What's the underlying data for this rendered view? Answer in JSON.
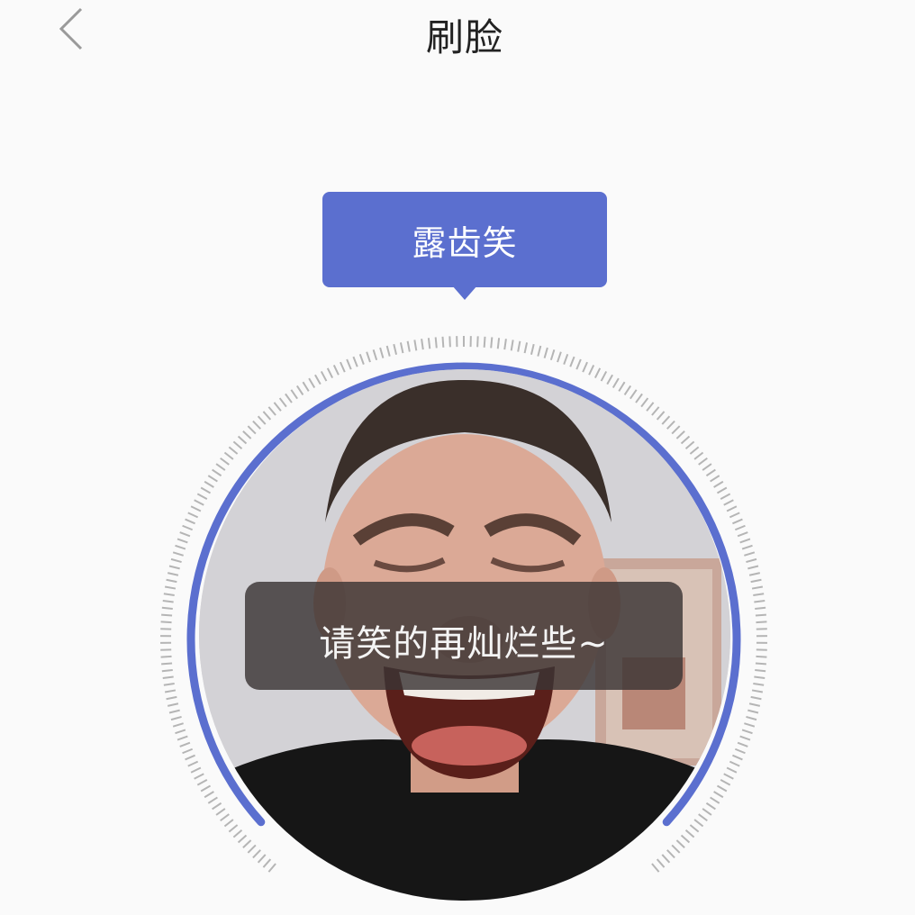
{
  "header": {
    "title": "刷脸",
    "back_icon": "chevron-left-icon"
  },
  "prompt": {
    "label": "露齿笑"
  },
  "camera": {
    "hint": "请笑的再灿烂些~"
  },
  "colors": {
    "accent": "#5b6fcf",
    "background": "#fafafa",
    "hint_background": "#3a3434",
    "tick_color": "#b5b5b5"
  }
}
